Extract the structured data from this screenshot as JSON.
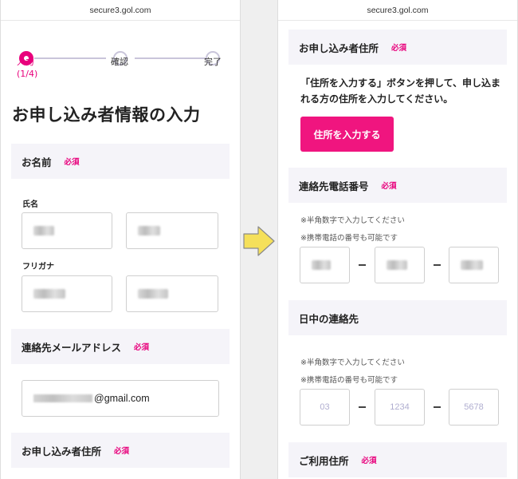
{
  "left": {
    "url": "secure3.gol.com",
    "steps": [
      {
        "label": "入力",
        "sub": "(1/4)"
      },
      {
        "label": "確認"
      },
      {
        "label": "完了"
      }
    ],
    "page_title": "お申し込み者情報の入力",
    "name_section": {
      "title": "お名前",
      "required": "必須"
    },
    "name_label": "氏名",
    "kana_label": "フリガナ",
    "email_section": {
      "title": "連絡先メールアドレス",
      "required": "必須"
    },
    "email_domain": "@gmail.com",
    "address_section": {
      "title": "お申し込み者住所",
      "required": "必須"
    }
  },
  "right": {
    "url": "secure3.gol.com",
    "address_section": {
      "title": "お申し込み者住所",
      "required": "必須"
    },
    "address_desc": "「住所を入力する」ボタンを押して、申し込まれる方の住所を入力してください。",
    "address_button": "住所を入力する",
    "phone_section": {
      "title": "連絡先電話番号",
      "required": "必須"
    },
    "phone_note1": "※半角数字で入力してください",
    "phone_note2": "※携帯電話の番号も可能です",
    "daytime_section": {
      "title": "日中の連絡先"
    },
    "daytime_note1": "※半角数字で入力してください",
    "daytime_note2": "※携帯電話の番号も可能です",
    "daytime_placeholders": [
      "03",
      "1234",
      "5678"
    ],
    "usage_section": {
      "title": "ご利用住所",
      "required": "必須"
    }
  },
  "colors": {
    "accent": "#e8007c",
    "button": "#f0157f",
    "arrow": "#f5e05a"
  }
}
